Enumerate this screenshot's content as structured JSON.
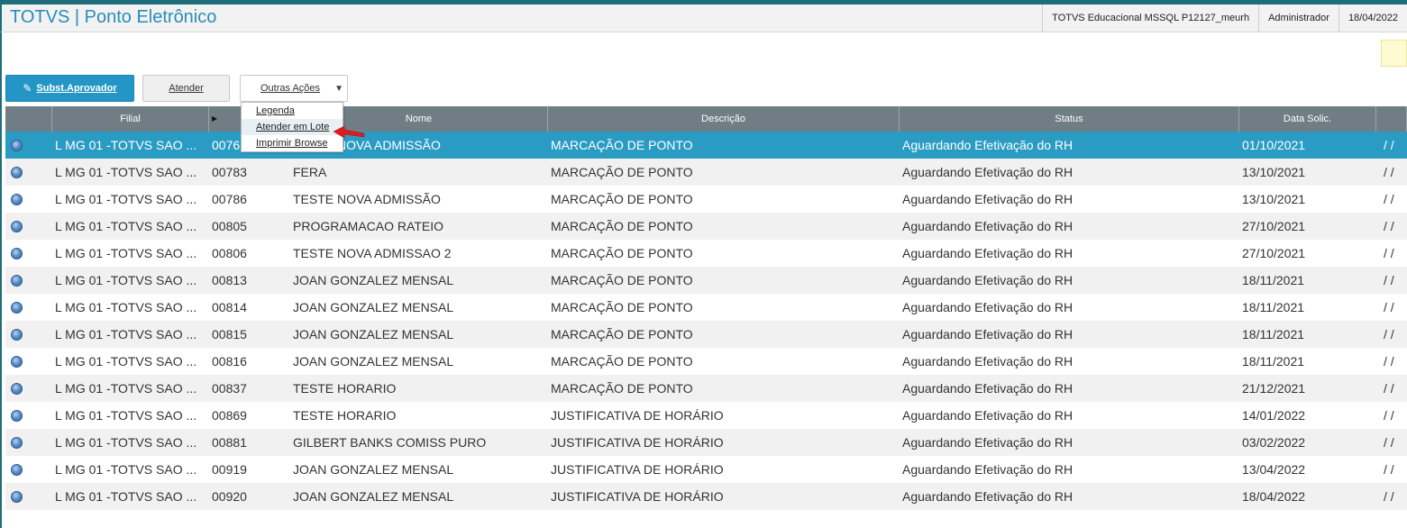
{
  "header": {
    "title": "TOTVS | Ponto Eletrônico",
    "environment": "TOTVS Educacional MSSQL P12127_meurh",
    "user": "Administrador",
    "date": "18/04/2022"
  },
  "toolbar": {
    "subst_aprovador": "Subst.Aprovador",
    "atender": "Atender",
    "outras_acoes": "Outras Ações"
  },
  "menu": {
    "items": [
      "Legenda",
      "Atender em Lote",
      "Imprimir Browse"
    ]
  },
  "grid": {
    "columns": [
      "",
      "Filial",
      "",
      "Nome",
      "Descrição",
      "Status",
      "Data Solic.",
      ""
    ],
    "rows": [
      {
        "filial": "L MG 01 -TOTVS SAO ...",
        "codigo": "00762",
        "nome": "TESTE NOVA ADMISSÃO",
        "descricao": "MARCAÇÃO DE PONTO",
        "status": "Aguardando Efetivação do RH",
        "data": "01/10/2021",
        "extra": "/ /"
      },
      {
        "filial": "L MG 01 -TOTVS SAO ...",
        "codigo": "00783",
        "nome": "FERA",
        "descricao": "MARCAÇÃO DE PONTO",
        "status": "Aguardando Efetivação do RH",
        "data": "13/10/2021",
        "extra": "/ /"
      },
      {
        "filial": "L MG 01 -TOTVS SAO ...",
        "codigo": "00786",
        "nome": "TESTE NOVA ADMISSÃO",
        "descricao": "MARCAÇÃO DE PONTO",
        "status": "Aguardando Efetivação do RH",
        "data": "13/10/2021",
        "extra": "/ /"
      },
      {
        "filial": "L MG 01 -TOTVS SAO ...",
        "codigo": "00805",
        "nome": "PROGRAMACAO RATEIO",
        "descricao": "MARCAÇÃO DE PONTO",
        "status": "Aguardando Efetivação do RH",
        "data": "27/10/2021",
        "extra": "/ /"
      },
      {
        "filial": "L MG 01 -TOTVS SAO ...",
        "codigo": "00806",
        "nome": "TESTE NOVA ADMISSAO 2",
        "descricao": "MARCAÇÃO DE PONTO",
        "status": "Aguardando Efetivação do RH",
        "data": "27/10/2021",
        "extra": "/ /"
      },
      {
        "filial": "L MG 01 -TOTVS SAO ...",
        "codigo": "00813",
        "nome": "JOAN GONZALEZ  MENSAL",
        "descricao": "MARCAÇÃO DE PONTO",
        "status": "Aguardando Efetivação do RH",
        "data": "18/11/2021",
        "extra": "/ /"
      },
      {
        "filial": "L MG 01 -TOTVS SAO ...",
        "codigo": "00814",
        "nome": "JOAN GONZALEZ  MENSAL",
        "descricao": "MARCAÇÃO DE PONTO",
        "status": "Aguardando Efetivação do RH",
        "data": "18/11/2021",
        "extra": "/ /"
      },
      {
        "filial": "L MG 01 -TOTVS SAO ...",
        "codigo": "00815",
        "nome": "JOAN GONZALEZ  MENSAL",
        "descricao": "MARCAÇÃO DE PONTO",
        "status": "Aguardando Efetivação do RH",
        "data": "18/11/2021",
        "extra": "/ /"
      },
      {
        "filial": "L MG 01 -TOTVS SAO ...",
        "codigo": "00816",
        "nome": "JOAN GONZALEZ  MENSAL",
        "descricao": "MARCAÇÃO DE PONTO",
        "status": "Aguardando Efetivação do RH",
        "data": "18/11/2021",
        "extra": "/ /"
      },
      {
        "filial": "L MG 01 -TOTVS SAO ...",
        "codigo": "00837",
        "nome": "TESTE HORARIO",
        "descricao": "MARCAÇÃO DE PONTO",
        "status": "Aguardando Efetivação do RH",
        "data": "21/12/2021",
        "extra": "/ /"
      },
      {
        "filial": "L MG 01 -TOTVS SAO ...",
        "codigo": "00869",
        "nome": "TESTE HORARIO",
        "descricao": "JUSTIFICATIVA DE HORÁRIO",
        "status": "Aguardando Efetivação do RH",
        "data": "14/01/2022",
        "extra": "/ /"
      },
      {
        "filial": "L MG 01 -TOTVS SAO ...",
        "codigo": "00881",
        "nome": "GILBERT BANKS COMISS PURO",
        "descricao": "JUSTIFICATIVA DE HORÁRIO",
        "status": "Aguardando Efetivação do RH",
        "data": "03/02/2022",
        "extra": "/ /"
      },
      {
        "filial": "L MG 01 -TOTVS SAO ...",
        "codigo": "00919",
        "nome": "JOAN GONZALEZ  MENSAL",
        "descricao": "JUSTIFICATIVA DE HORÁRIO",
        "status": "Aguardando Efetivação do RH",
        "data": "13/04/2022",
        "extra": "/ /"
      },
      {
        "filial": "L MG 01 -TOTVS SAO ...",
        "codigo": "00920",
        "nome": "JOAN GONZALEZ  MENSAL",
        "descricao": "JUSTIFICATIVA DE HORÁRIO",
        "status": "Aguardando Efetivação do RH",
        "data": "18/04/2022",
        "extra": "/ /"
      }
    ]
  },
  "colors": {
    "accent": "#2a9cc4",
    "header_bar": "#707d84",
    "title": "#2a8cba"
  }
}
